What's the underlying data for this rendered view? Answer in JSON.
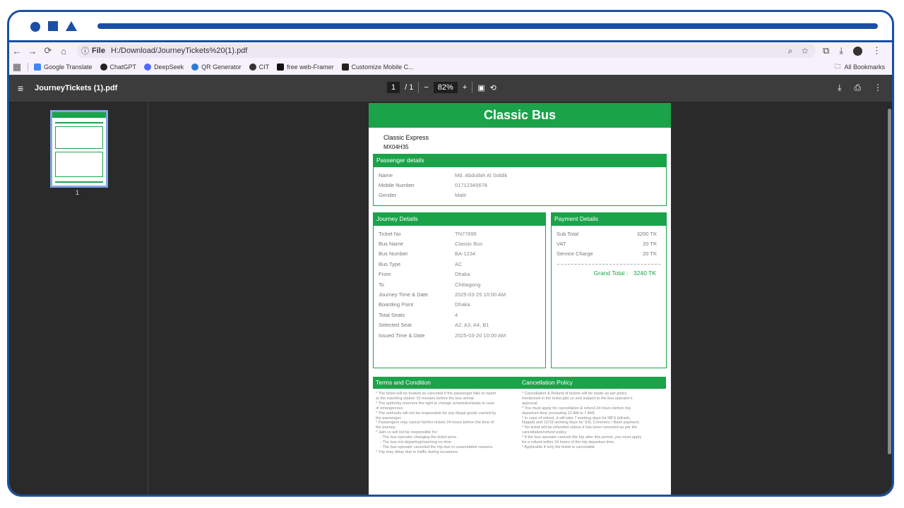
{
  "browser": {
    "url_scheme": "File",
    "url": "H:/Download/JourneyTickets%20(1).pdf",
    "bookmarks": [
      "Google Translate",
      "ChatGPT",
      "DeepSeek",
      "QR Generator",
      "CIT",
      "free web-Framer",
      "Customize Mobile C..."
    ],
    "all_bookmarks": "All Bookmarks"
  },
  "pdf": {
    "filename": "JourneyTickets (1).pdf",
    "current_page": "1",
    "total_pages": "/ 1",
    "zoom": "82%",
    "thumb_page": "1"
  },
  "ticket": {
    "title": "Classic Bus",
    "company": "Classic Express",
    "plate": "MX04H35",
    "passenger": {
      "header": "Passenger details",
      "rows": [
        {
          "k": "Name",
          "v": "Md. Abdullah Al Siddik"
        },
        {
          "k": "Mobile Number",
          "v": "01712345678"
        },
        {
          "k": "Gender",
          "v": "Male"
        }
      ]
    },
    "journey": {
      "header": "Journey Details",
      "rows": [
        {
          "k": "Ticket No",
          "v": "TN77695"
        },
        {
          "k": "Bus Name",
          "v": "Classic Bus"
        },
        {
          "k": "Bus Number",
          "v": "BA-1234"
        },
        {
          "k": "Bus Type",
          "v": "AC"
        },
        {
          "k": "From",
          "v": "Dhaka"
        },
        {
          "k": "To",
          "v": "Chittagong"
        },
        {
          "k": "Journey Time & Date",
          "v": "2025-03-25 10:00 AM"
        },
        {
          "k": "Boarding Point",
          "v": "Dhaka"
        },
        {
          "k": "Total Seats",
          "v": "4"
        },
        {
          "k": "Selected Seat",
          "v": "A2, A3, A4, B1"
        },
        {
          "k": "Issued Time & Date",
          "v": "2025-03-20 10:00 AM"
        }
      ]
    },
    "payment": {
      "header": "Payment Details",
      "rows": [
        {
          "k": "Sub Total",
          "v": "3200 TK"
        },
        {
          "k": "VAT",
          "v": "20 TK"
        },
        {
          "k": "Service Charge",
          "v": "20 TK"
        }
      ],
      "grand_label": "Grand Total :",
      "grand_value": "3240 TK"
    },
    "terms": {
      "header": "Terms and Condition",
      "text": "* The ticket will be treated as canceled if the passenger fails to report\nat the reporting station 15 minutes before the bus arrival.\n* The authority reserves the right to change schedules/seats in case\nof emergencies.\n* The authority will not be responsible for any illegal goods carried by\nthe passenger.\n* Passengers may cancel his/her tickets 24 hours before the time of\nthe journey.\n* Jatri.co will not be responsible for:\n    - The bus operator changing the ticket price.\n    - The bus not departing/reaching on time.\n    - The bus operator canceled the trip due to unavoidable reasons.\n* Trip may delay due to traffic during occasions."
    },
    "cancellation": {
      "header": "Cancellation Policy",
      "text": "* Cancellation & Refund of tickets will be made as per policy\nmentioned in the ticket.jatri.co and subject to the bus operator's\napproval.\n* You must apply for cancellation & refund 24 hours before trip\ndeparture time (excluding 12 AM to 7 AM)\n* In case of refund, it will take 7 working days for MFS (bKash,\nNagad) and 12/15 working days for SSL Commerz / Bank payment.\n* No ticket will be refunded unless it has been canceled as per the\ncancellation/refund policy.\n* If the bus operator cancels the trip after this period, you must apply\nfor a refund within 24 hours of the trip departure time.\n* Applicable if only the ticket is cancelable."
    }
  }
}
